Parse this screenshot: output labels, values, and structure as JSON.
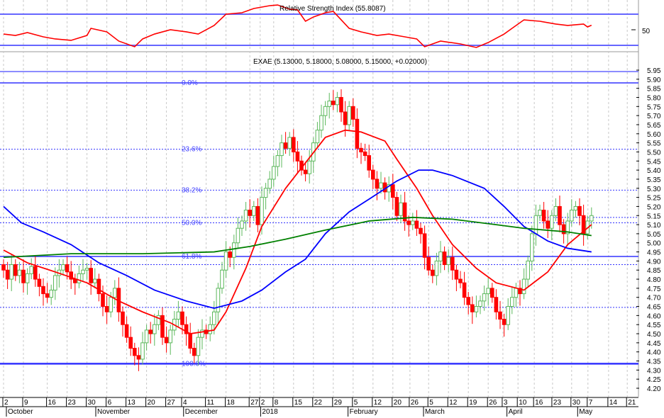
{
  "rsi_panel": {
    "title": "Relative Strength Index (55.8087)",
    "level_label": "50",
    "upper_level": 70,
    "lower_level": 30
  },
  "price_panel": {
    "title": "EXAE (5.13000, 5.18000, 5.08000, 5.15000, +0.02000)"
  },
  "colors": {
    "up": "#5cb85c",
    "up_fill": "#ffffff",
    "down": "#ff0000",
    "ma_fast": "#ff0000",
    "ma_mid": "#0000ff",
    "ma_slow": "#008000",
    "rsi_line": "#ff0000",
    "levels": "#3333ff",
    "grid": "#c8c8c8"
  },
  "chart_data": {
    "type": "candlestick",
    "title": "EXAE (5.13000, 5.18000, 5.08000, 5.15000, +0.02000)",
    "ylim": [
      4.2,
      5.95
    ],
    "y_ticks": [
      "5.95",
      "5.90",
      "5.85",
      "5.80",
      "5.75",
      "5.70",
      "5.65",
      "5.60",
      "5.55",
      "5.50",
      "5.45",
      "5.40",
      "5.35",
      "5.30",
      "5.25",
      "5.20",
      "5.15",
      "5.10",
      "5.05",
      "5.00",
      "4.95",
      "4.90",
      "4.85",
      "4.80",
      "4.75",
      "4.70",
      "4.65",
      "4.60",
      "4.55",
      "4.50",
      "4.45",
      "4.40",
      "4.35",
      "4.30",
      "4.25",
      "4.20"
    ],
    "x_ticks": [
      {
        "label": "2",
        "day": 0
      },
      {
        "label": "9",
        "day": 5
      },
      {
        "label": "16",
        "day": 11
      },
      {
        "label": "23",
        "day": 16
      },
      {
        "label": "30",
        "day": 21
      },
      {
        "label": "6",
        "day": 26
      },
      {
        "label": "13",
        "day": 31
      },
      {
        "label": "20",
        "day": 36
      },
      {
        "label": "27",
        "day": 41
      },
      {
        "label": "4",
        "day": 45
      },
      {
        "label": "11",
        "day": 51
      },
      {
        "label": "18",
        "day": 56
      },
      {
        "label": "27",
        "day": 62
      },
      {
        "label": "2",
        "day": 64.6
      },
      {
        "label": "8",
        "day": 68
      },
      {
        "label": "15",
        "day": 73
      },
      {
        "label": "22",
        "day": 78
      },
      {
        "label": "29",
        "day": 83
      },
      {
        "label": "5",
        "day": 88
      },
      {
        "label": "12",
        "day": 93
      },
      {
        "label": "20",
        "day": 98
      },
      {
        "label": "26",
        "day": 102.3
      },
      {
        "label": "5",
        "day": 107
      },
      {
        "label": "12",
        "day": 112
      },
      {
        "label": "19",
        "day": 117
      },
      {
        "label": "26",
        "day": 122
      },
      {
        "label": "3",
        "day": 125.7
      },
      {
        "label": "10",
        "day": 129.5
      },
      {
        "label": "16",
        "day": 133.6
      },
      {
        "label": "23",
        "day": 138.2
      },
      {
        "label": "30",
        "day": 143
      },
      {
        "label": "7",
        "day": 147.1
      },
      {
        "label": "14",
        "day": 152.3
      },
      {
        "label": "21",
        "day": 157
      }
    ],
    "months": [
      {
        "label": "October",
        "day": 0
      },
      {
        "label": "November",
        "day": 22.5
      },
      {
        "label": "December",
        "day": 44.6
      },
      {
        "label": "2018",
        "day": 64
      },
      {
        "label": "February",
        "day": 86
      },
      {
        "label": "March",
        "day": 105
      },
      {
        "label": "April",
        "day": 126
      },
      {
        "label": "May",
        "day": 143.8
      }
    ],
    "first_open": 4.88,
    "closes": [
      4.85,
      4.8,
      4.88,
      4.82,
      4.85,
      4.78,
      4.83,
      4.87,
      4.8,
      4.76,
      4.72,
      4.7,
      4.74,
      4.82,
      4.85,
      4.88,
      4.84,
      4.8,
      4.78,
      4.83,
      4.85,
      4.86,
      4.78,
      4.8,
      4.72,
      4.65,
      4.62,
      4.7,
      4.75,
      4.62,
      4.55,
      4.48,
      4.42,
      4.38,
      4.36,
      4.45,
      4.52,
      4.5,
      4.55,
      4.6,
      4.48,
      4.45,
      4.52,
      4.58,
      4.62,
      4.55,
      4.5,
      4.42,
      4.38,
      4.48,
      4.52,
      4.5,
      4.55,
      4.62,
      4.75,
      4.85,
      4.95,
      4.92,
      5.0,
      5.08,
      5.12,
      5.18,
      5.15,
      5.2,
      5.1,
      5.25,
      5.3,
      5.35,
      5.42,
      5.48,
      5.55,
      5.52,
      5.58,
      5.5,
      5.45,
      5.4,
      5.38,
      5.45,
      5.55,
      5.62,
      5.7,
      5.75,
      5.78,
      5.76,
      5.8,
      5.72,
      5.65,
      5.75,
      5.68,
      5.52,
      5.5,
      5.48,
      5.4,
      5.35,
      5.3,
      5.33,
      5.28,
      5.32,
      5.25,
      5.15,
      5.22,
      5.12,
      5.1,
      5.12,
      5.08,
      5.05,
      4.92,
      4.85,
      4.82,
      4.9,
      4.95,
      4.88,
      4.92,
      4.85,
      4.8,
      4.78,
      4.7,
      4.66,
      4.62,
      4.65,
      4.68,
      4.72,
      4.75,
      4.7,
      4.62,
      4.58,
      4.55,
      4.65,
      4.7,
      4.75,
      4.72,
      4.8,
      4.9,
      5.05,
      5.15,
      5.18,
      5.12,
      5.08,
      5.15,
      5.2,
      5.1,
      5.05,
      5.12,
      5.18,
      5.2,
      5.15,
      5.05,
      5.12,
      5.15
    ],
    "moving_averages": [
      {
        "name": "fast",
        "color_key": "ma_fast",
        "points": [
          [
            0,
            4.96
          ],
          [
            6,
            4.89
          ],
          [
            13,
            4.84
          ],
          [
            21,
            4.78
          ],
          [
            29,
            4.68
          ],
          [
            35,
            4.62
          ],
          [
            42,
            4.56
          ],
          [
            47,
            4.5
          ],
          [
            53,
            4.52
          ],
          [
            56,
            4.62
          ],
          [
            61,
            4.86
          ],
          [
            65,
            5.09
          ],
          [
            71,
            5.3
          ],
          [
            76,
            5.44
          ],
          [
            81,
            5.58
          ],
          [
            86,
            5.62
          ],
          [
            90,
            5.61
          ],
          [
            96,
            5.56
          ],
          [
            99,
            5.46
          ],
          [
            104,
            5.3
          ],
          [
            108,
            5.15
          ],
          [
            113,
            4.99
          ],
          [
            119,
            4.86
          ],
          [
            124,
            4.78
          ],
          [
            131,
            4.74
          ],
          [
            137,
            4.84
          ],
          [
            142,
            4.99
          ],
          [
            148,
            5.1
          ]
        ]
      },
      {
        "name": "mid",
        "color_key": "ma_mid",
        "points": [
          [
            0,
            5.2
          ],
          [
            4.5,
            5.11
          ],
          [
            10,
            5.06
          ],
          [
            17,
            4.99
          ],
          [
            24,
            4.89
          ],
          [
            31,
            4.82
          ],
          [
            38,
            4.74
          ],
          [
            46,
            4.68
          ],
          [
            53,
            4.64
          ],
          [
            60,
            4.68
          ],
          [
            65,
            4.74
          ],
          [
            71,
            4.84
          ],
          [
            76,
            4.91
          ],
          [
            81,
            5.05
          ],
          [
            87,
            5.17
          ],
          [
            92,
            5.24
          ],
          [
            99,
            5.34
          ],
          [
            104.5,
            5.4
          ],
          [
            108,
            5.4
          ],
          [
            113,
            5.37
          ],
          [
            121,
            5.3
          ],
          [
            126,
            5.2
          ],
          [
            131,
            5.09
          ],
          [
            137,
            5.01
          ],
          [
            142,
            4.97
          ],
          [
            148,
            4.95
          ]
        ]
      },
      {
        "name": "slow",
        "color_key": "ma_slow",
        "points": [
          [
            0,
            4.92
          ],
          [
            17,
            4.94
          ],
          [
            35,
            4.94
          ],
          [
            53,
            4.95
          ],
          [
            62,
            4.98
          ],
          [
            71,
            5.02
          ],
          [
            81,
            5.07
          ],
          [
            92,
            5.12
          ],
          [
            103,
            5.14
          ],
          [
            113,
            5.13
          ],
          [
            124,
            5.1
          ],
          [
            131,
            5.08
          ],
          [
            142,
            5.06
          ],
          [
            148,
            5.04
          ]
        ]
      }
    ],
    "horizontal_lines": [
      {
        "price": 5.88,
        "style": "solid",
        "label": "0.0%"
      },
      {
        "price": 5.515,
        "style": "dotted",
        "label": "23.6%"
      },
      {
        "price": 5.29,
        "style": "dotted",
        "label": "38.2%"
      },
      {
        "price": 5.14,
        "style": "dotted",
        "label": ""
      },
      {
        "price": 5.11,
        "style": "dotted",
        "label": "50.0%"
      },
      {
        "price": 4.925,
        "style": "solid",
        "label": "61.8%"
      },
      {
        "price": 4.88,
        "style": "dotted",
        "label": ""
      },
      {
        "price": 4.645,
        "style": "dotted",
        "label": ""
      },
      {
        "price": 4.335,
        "style": "thick",
        "label": "100.0%"
      }
    ],
    "rsi": {
      "ylim": [
        0,
        100
      ],
      "points": [
        [
          0,
          44.5
        ],
        [
          3,
          42.7
        ],
        [
          6,
          46.4
        ],
        [
          10,
          40.9
        ],
        [
          13,
          38.2
        ],
        [
          17,
          36.4
        ],
        [
          21,
          42.7
        ],
        [
          22,
          51.8
        ],
        [
          26,
          47.3
        ],
        [
          29,
          35.5
        ],
        [
          33,
          28.2
        ],
        [
          35,
          38.2
        ],
        [
          38,
          44.5
        ],
        [
          42,
          50
        ],
        [
          46,
          47.3
        ],
        [
          49,
          44.5
        ],
        [
          53,
          55.5
        ],
        [
          56,
          70
        ],
        [
          60,
          71.8
        ],
        [
          63,
          77.3
        ],
        [
          67,
          80.9
        ],
        [
          69,
          81.8
        ],
        [
          72,
          76.4
        ],
        [
          74,
          75.5
        ],
        [
          76,
          60.9
        ],
        [
          78,
          66.4
        ],
        [
          81,
          71.8
        ],
        [
          83,
          73.6
        ],
        [
          87,
          51.8
        ],
        [
          90,
          47.3
        ],
        [
          94,
          42.7
        ],
        [
          97,
          44.5
        ],
        [
          101,
          40.9
        ],
        [
          104,
          38.2
        ],
        [
          106,
          28.2
        ],
        [
          110,
          35.5
        ],
        [
          115,
          31.8
        ],
        [
          119,
          27.3
        ],
        [
          122,
          33.6
        ],
        [
          126,
          44.5
        ],
        [
          128,
          51.8
        ],
        [
          131,
          62.7
        ],
        [
          135,
          60.9
        ],
        [
          139,
          57.3
        ],
        [
          142,
          55.5
        ],
        [
          146,
          57.3
        ],
        [
          147,
          53.6
        ],
        [
          148,
          55.8
        ]
      ]
    }
  }
}
